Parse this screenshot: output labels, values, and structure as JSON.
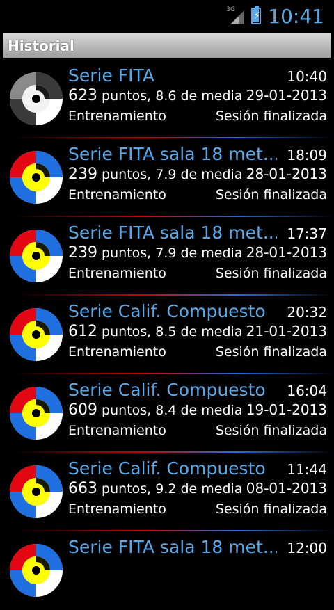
{
  "statusbar": {
    "network": "3G",
    "time": "10:41"
  },
  "header": {
    "title": "Historial"
  },
  "sessions": [
    {
      "title": "Serie FITA",
      "time": "10:40",
      "points": "623",
      "average": "puntos, 8.6 de media",
      "date": "29-01-2013",
      "mode": "Entrenamiento",
      "state": "Sesión finalizada",
      "icon": "gray"
    },
    {
      "title": "Serie FITA sala 18 met...",
      "time": "18:09",
      "points": "239",
      "average": "puntos, 7.9 de media",
      "date": "28-01-2013",
      "mode": "Entrenamiento",
      "state": "Sesión finalizada",
      "icon": "color"
    },
    {
      "title": "Serie FITA sala 18 met...",
      "time": "17:37",
      "points": "239",
      "average": "puntos, 7.9 de media",
      "date": "28-01-2013",
      "mode": "Entrenamiento",
      "state": "Sesión finalizada",
      "icon": "color"
    },
    {
      "title": "Serie Calif. Compuesto",
      "time": "20:32",
      "points": "612",
      "average": "puntos, 8.5 de media",
      "date": "21-01-2013",
      "mode": "Entrenamiento",
      "state": "Sesión finalizada",
      "icon": "color"
    },
    {
      "title": "Serie Calif. Compuesto",
      "time": "16:04",
      "points": "609",
      "average": "puntos, 8.4 de media",
      "date": "19-01-2013",
      "mode": "Entrenamiento",
      "state": "Sesión finalizada",
      "icon": "color"
    },
    {
      "title": "Serie Calif. Compuesto",
      "time": "11:44",
      "points": "663",
      "average": "puntos, 9.2 de media",
      "date": "08-01-2013",
      "mode": "Entrenamiento",
      "state": "Sesión finalizada",
      "icon": "color"
    },
    {
      "title": "Serie FITA sala 18 met...",
      "time": "12:00",
      "points": "",
      "average": "",
      "date": "",
      "mode": "",
      "state": "",
      "icon": "color"
    }
  ],
  "colors": {
    "accent": "#5aa9e6",
    "red": "#e30613",
    "blue": "#1f6fe0",
    "yellow": "#ffff00"
  }
}
